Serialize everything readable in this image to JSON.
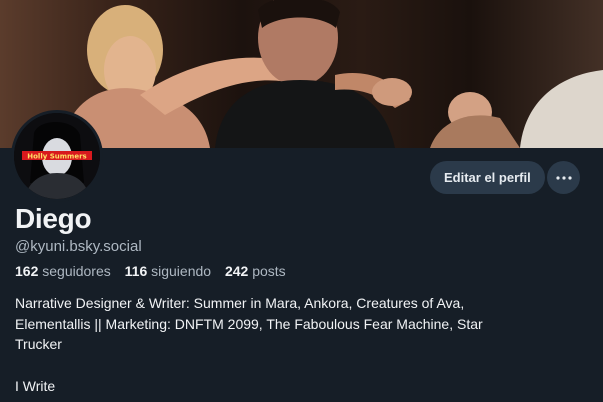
{
  "profile": {
    "display_name": "Diego",
    "handle": "@kyuni.bsky.social",
    "avatar_caption": "Holly Summers",
    "stats": {
      "followers_count": "162",
      "followers_label": "seguidores",
      "following_count": "116",
      "following_label": "siguiendo",
      "posts_count": "242",
      "posts_label": "posts"
    },
    "bio_lines": [
      "Narrative Designer & Writer: Summer in Mara, Ankora, Creatures of Ava,",
      "Elementallis || Marketing: DNFTM 2099, The Faboulous Fear Machine, Star",
      "Trucker",
      "I Write"
    ]
  },
  "actions": {
    "edit_label": "Editar el perfil",
    "more_icon": "ellipsis-icon"
  },
  "colors": {
    "background": "#161e27",
    "button_bg": "#2b3a4a",
    "muted_text": "#aeb8c2",
    "text": "#f1f3f5"
  }
}
